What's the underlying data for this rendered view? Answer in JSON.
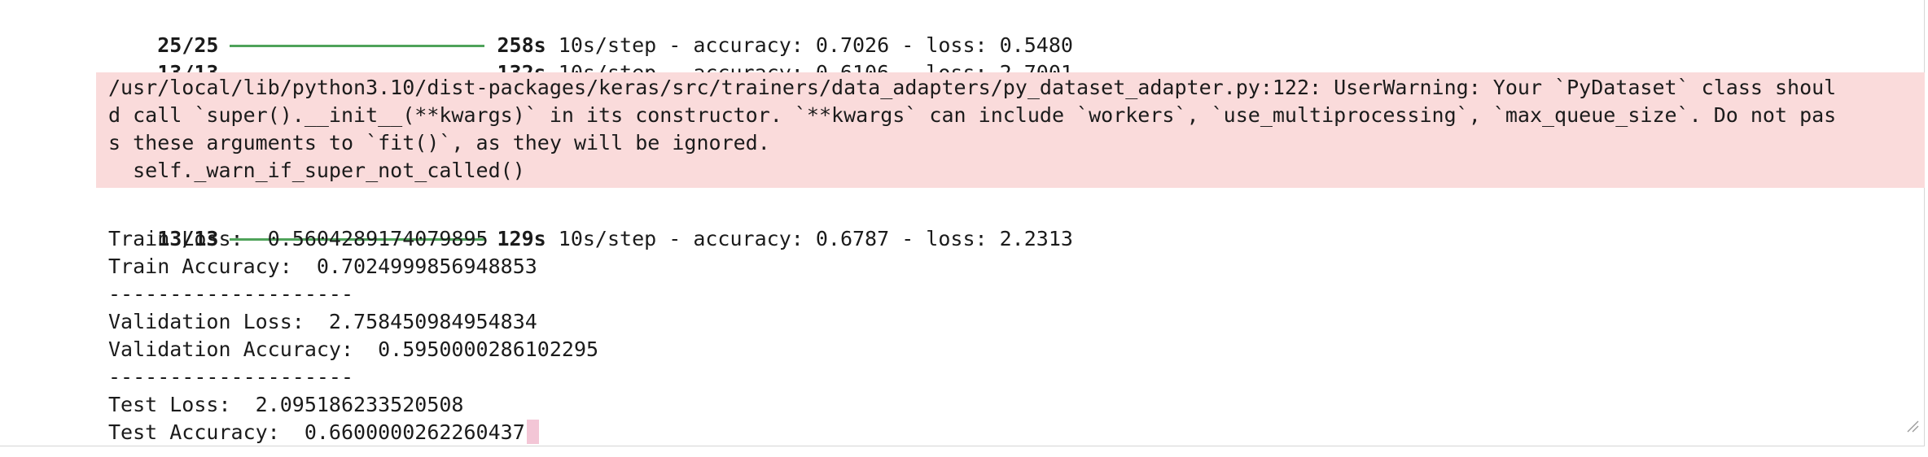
{
  "progress_top": [
    {
      "count": "25/25",
      "time": "258s",
      "rest": "10s/step - accuracy: 0.7026 - loss: 0.5480"
    },
    {
      "count": "13/13",
      "time": "132s",
      "rest": "10s/step - accuracy: 0.6106 - loss: 2.7001"
    }
  ],
  "warning_lines": [
    "/usr/local/lib/python3.10/dist-packages/keras/src/trainers/data_adapters/py_dataset_adapter.py:122: UserWarning: Your `PyDataset` class shoul",
    "d call `super().__init__(**kwargs)` in its constructor. `**kwargs` can include `workers`, `use_multiprocessing`, `max_queue_size`. Do not pas",
    "s these arguments to `fit()`, as they will be ignored.",
    "  self._warn_if_super_not_called()"
  ],
  "progress_bottom": {
    "count": "13/13",
    "time": "129s",
    "rest": "10s/step - accuracy: 0.6787 - loss: 2.2313"
  },
  "results": [
    "Train Loss:  0.5604289174079895",
    "Train Accuracy:  0.7024999856948853",
    "--------------------",
    "Validation Loss:  2.758450984954834",
    "Validation Accuracy:  0.5950000286102295",
    "--------------------",
    "Test Loss:  2.095186233520508",
    "Test Accuracy:  0.6600000262260437"
  ],
  "colors": {
    "progress_bar": "#4fa35a",
    "stderr_background": "#fadbdb",
    "cursor": "#f3c6d6"
  }
}
